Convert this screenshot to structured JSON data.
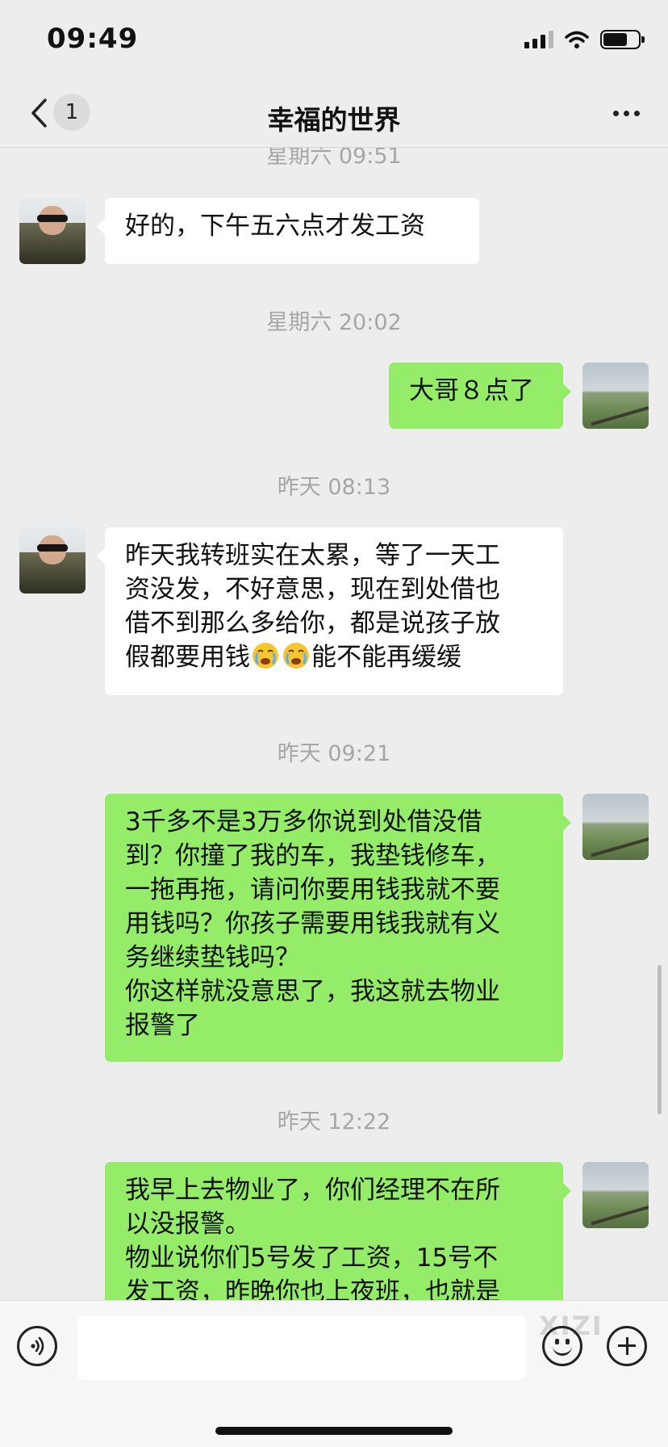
{
  "status_bar": {
    "time": "09:49"
  },
  "nav": {
    "badge": "1",
    "title": "幸福的世界"
  },
  "messages": {
    "ts0": "星期六 09:51",
    "m1": "好的，下午五六点才发工资",
    "ts1": "星期六 20:02",
    "m2": "大哥８点了",
    "ts2": "昨天 08:13",
    "m3": {
      "l1": "昨天我转班实在太累，等了一天工",
      "l2": "资没发，不好意思，现在到处借也",
      "l3": "借不到那么多给你，都是说孩子放",
      "l4a": "假都要用钱",
      "l4b": "能不能再缓缓",
      "emoji": "crying-face"
    },
    "ts3": "昨天 09:21",
    "m4": {
      "l1": "3千多不是3万多你说到处借没借",
      "l2": "到？你撞了我的车，我垫钱修车，",
      "l3": "一拖再拖，请问你要用钱我就不要",
      "l4": "用钱吗？你孩子需要用钱我就有义",
      "l5": "务继续垫钱吗？",
      "l6": "你这样就没意思了，我这就去物业",
      "l7": "报警了"
    },
    "ts4": "昨天 12:22",
    "m5": {
      "l1": "我早上去物业了，你们经理不在所",
      "l2": "以没报警。",
      "l3": "物业说你们5号发了工资，15号不",
      "l4": "发工资，昨晚你也上夜班，也就是"
    }
  },
  "input": {
    "value": ""
  },
  "watermark": "XIZI",
  "colors": {
    "self_bubble": "#95ec69",
    "other_bubble": "#ffffff",
    "background": "#ededed"
  }
}
